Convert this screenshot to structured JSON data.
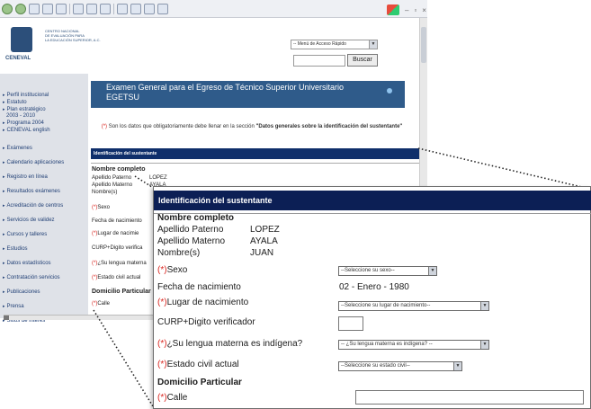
{
  "browser": {
    "toolbar_icons": [
      "back-icon",
      "forward-icon",
      "stop-icon",
      "refresh-icon",
      "home-icon",
      "search-icon",
      "favorites-icon",
      "history-icon",
      "mail-icon",
      "print-icon",
      "edit-icon",
      "messenger-icon"
    ]
  },
  "header": {
    "org_name_lines": [
      "Centro Nacional",
      "de Evaluación para",
      "la Educación Superior, A.C."
    ],
    "logo_text": "CENEVAL",
    "quick_menu": "-- Menú de Acceso Rápido",
    "search_button": "Buscar"
  },
  "sidebar": {
    "items": [
      {
        "label": "Perfil institucional"
      },
      {
        "label": "Estatuto"
      },
      {
        "label": "Plan estratégico"
      },
      {
        "label": "Programa 2004"
      },
      {
        "label": "CENEVAL english"
      },
      {
        "label": "Exámenes"
      },
      {
        "label": "Calendario aplicaciones"
      },
      {
        "label": "Registro en línea"
      },
      {
        "label": "Resultados exámenes"
      },
      {
        "label": "Acreditación de centros"
      },
      {
        "label": "Servicios de validez"
      },
      {
        "label": "Cursos y talleres"
      },
      {
        "label": "Estudios"
      },
      {
        "label": "Datos estadísticos"
      },
      {
        "label": "Contratación servicios"
      },
      {
        "label": "Publicaciones"
      },
      {
        "label": "Prensa"
      },
      {
        "label": "Sitios de interés"
      }
    ],
    "plan_sub": "2003 - 2010"
  },
  "main": {
    "title_line1": "Examen General para el Egreso de Técnico Superior Universitario",
    "title_line2": "EGETSU",
    "notice_prefix": "(*)",
    "notice_text": " Son los datos que obligatoriamente debe llenar en la sección ",
    "notice_bold": "\"Datos generales sobre la identificación del sustentante\"",
    "section_title": "Identificación del sustentante",
    "fields_small": {
      "nombre_completo": "Nombre completo",
      "apellido_paterno": "Apellido Paterno",
      "apellido_materno": "Apellido Materno",
      "nombres": "Nombre(s)",
      "sexo": "Sexo",
      "fecha_nacimiento": "Fecha de nacimiento",
      "lugar_nacimiento": "Lugar de nacimie",
      "curp": "CURP+Digito verifica",
      "lengua": "¿Su lengua materna",
      "estado_civil": "Estado civil actual",
      "domicilio": "Domicilio Particular",
      "calle": "Calle"
    },
    "values": {
      "apellido_paterno": "LOPEZ",
      "apellido_materno": "AYALA"
    }
  },
  "zoom": {
    "section_title": "Identificación del sustentante",
    "nombre_completo": "Nombre completo",
    "apellido_paterno_label": "Apellido Paterno",
    "apellido_paterno_value": "LOPEZ",
    "apellido_materno_label": "Apellido Materno",
    "apellido_materno_value": "AYALA",
    "nombres_label": "Nombre(s)",
    "nombres_value": "JUAN",
    "required_marker": "(*)",
    "sexo_label": "Sexo",
    "sexo_select": "--Seleccione su sexo--",
    "fecha_label": "Fecha de nacimiento",
    "fecha_value": "02 - Enero - 1980",
    "lugar_label": "Lugar de nacimiento",
    "lugar_select": "--Seleccione su lugar de nacimiento--",
    "curp_label": "CURP+Digito verificador",
    "lengua_label": "¿Su lengua materna es indígena?",
    "lengua_select": "-- ¿Su lengua materna es indígena? --",
    "estado_label": "Estado civil actual",
    "estado_select": "--Seleccione su estado civil--",
    "domicilio_label": "Domicilio Particular",
    "calle_label": "Calle"
  },
  "colors": {
    "banner": "#2f5b8a",
    "section_bar": "#0c1f55",
    "required": "#d9241e",
    "sidebar_bg": "#dfe2e8",
    "link": "#1f3e74"
  }
}
